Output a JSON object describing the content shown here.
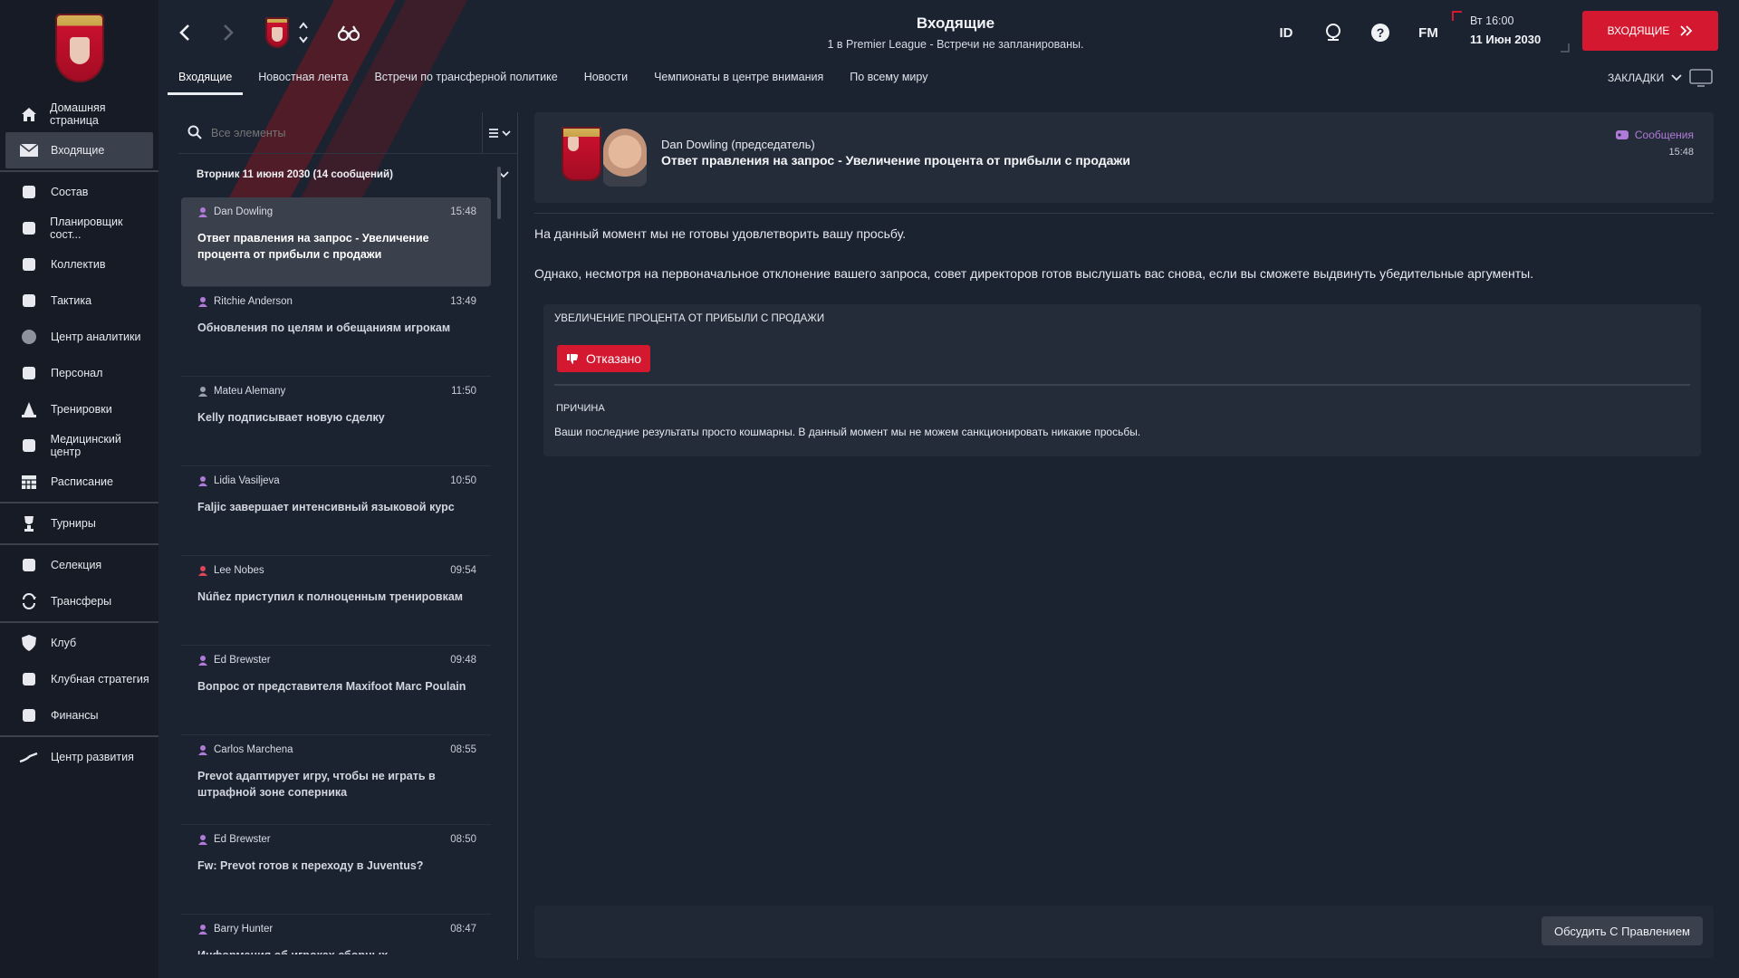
{
  "colors": {
    "accent_red": "#d3182f",
    "sidebar_bg": "#161b26",
    "panel_bg": "#252c39",
    "category_purple": "#b07ad8"
  },
  "sidebar": {
    "items": [
      {
        "label": "Домашняя страница",
        "icon": "home-icon"
      },
      {
        "label": "Входящие",
        "icon": "mail-icon",
        "active": true
      },
      {
        "label": "Состав",
        "icon": "shirt-icon"
      },
      {
        "label": "Планировщик сост...",
        "icon": "clipboard-icon"
      },
      {
        "label": "Коллектив",
        "icon": "group-icon"
      },
      {
        "label": "Тактика",
        "icon": "tactics-icon"
      },
      {
        "label": "Центр аналитики",
        "icon": "analytics-icon"
      },
      {
        "label": "Персонал",
        "icon": "staff-icon"
      },
      {
        "label": "Тренировки",
        "icon": "cone-icon"
      },
      {
        "label": "Медицинский центр",
        "icon": "medical-icon"
      },
      {
        "label": "Расписание",
        "icon": "calendar-icon"
      },
      {
        "label": "Турниры",
        "icon": "trophy-icon"
      },
      {
        "label": "Селекция",
        "icon": "binoculars-icon"
      },
      {
        "label": "Трансферы",
        "icon": "transfer-icon"
      },
      {
        "label": "Клуб",
        "icon": "shield-icon"
      },
      {
        "label": "Клубная стратегия",
        "icon": "briefcase-icon"
      },
      {
        "label": "Финансы",
        "icon": "money-icon"
      },
      {
        "label": "Центр развития",
        "icon": "growth-icon"
      }
    ]
  },
  "header": {
    "title": "Входящие",
    "subtitle": "1 в Premier League - Встречи не запланированы.",
    "id_label": "ID",
    "fm_label": "FM",
    "day_time": "Вт 16:00",
    "date": "11 Июн 2030",
    "continue_label": "ВХОДЯЩИЕ",
    "bookmarks_label": "ЗАКЛАДКИ",
    "tabs": [
      {
        "label": "Входящие",
        "active": true
      },
      {
        "label": "Новостная лента"
      },
      {
        "label": "Встречи по трансферной политике"
      },
      {
        "label": "Новости"
      },
      {
        "label": "Чемпионаты в центре внимания"
      },
      {
        "label": "По всему миру"
      }
    ]
  },
  "list": {
    "search_placeholder": "Все элементы",
    "group_header": "Вторник 11 июня 2030 (14 сообщений)",
    "messages": [
      {
        "sender": "Dan Dowling",
        "time": "15:48",
        "subject": "Ответ правления на запрос - Увеличение процента от прибыли с продажи",
        "selected": true,
        "icon_color": "#b07ad8"
      },
      {
        "sender": "Ritchie Anderson",
        "time": "13:49",
        "subject": "Обновления по целям и обещаниям игрокам",
        "icon_color": "#b07ad8"
      },
      {
        "sender": "Mateu Alemany",
        "time": "11:50",
        "subject": "Kelly подписывает новую сделку",
        "icon_color": "#9aa0ab"
      },
      {
        "sender": "Lidia Vasiljeva",
        "time": "10:50",
        "subject": "Faljic завершает интенсивный языковой курс",
        "icon_color": "#b07ad8"
      },
      {
        "sender": "Lee Nobes",
        "time": "09:54",
        "subject": "Núñez приступил к полноценным тренировкам",
        "icon_color": "#e0455a"
      },
      {
        "sender": "Ed Brewster",
        "time": "09:48",
        "subject": "Вопрос от представителя Maxifoot Marc Poulain",
        "icon_color": "#b07ad8"
      },
      {
        "sender": "Carlos Marchena",
        "time": "08:55",
        "subject": "Prevot адаптирует игру, чтобы не играть в штрафной зоне соперника",
        "icon_color": "#b07ad8"
      },
      {
        "sender": "Ed Brewster",
        "time": "08:50",
        "subject": "Fw: Prevot готов к переходу в Juventus?",
        "icon_color": "#b07ad8"
      },
      {
        "sender": "Barry Hunter",
        "time": "08:47",
        "subject": "Информация об игроках сборных",
        "icon_color": "#b07ad8"
      }
    ]
  },
  "detail": {
    "sender": "Dan Dowling  (председатель)",
    "subject": "Ответ правления на запрос - Увеличение процента от прибыли с продажи",
    "category": "Сообщения",
    "time": "15:48",
    "para1": "На данный момент мы не готовы удовлетворить вашу просьбу.",
    "para2": "Однако, несмотря на первоначальное отклонение вашего запроса, совет директоров готов выслушать вас снова, если вы сможете выдвинуть убедительные аргументы.",
    "request_title": "УВЕЛИЧЕНИЕ ПРОЦЕНТА ОТ ПРИБЫЛИ С ПРОДАЖИ",
    "status": "Отказано",
    "reason_label": "ПРИЧИНА",
    "reason_text": "Ваши последние результаты просто кошмарны. В данный момент мы не можем санкционировать никакие просьбы.",
    "discuss_label": "Обсудить С Правлением"
  }
}
